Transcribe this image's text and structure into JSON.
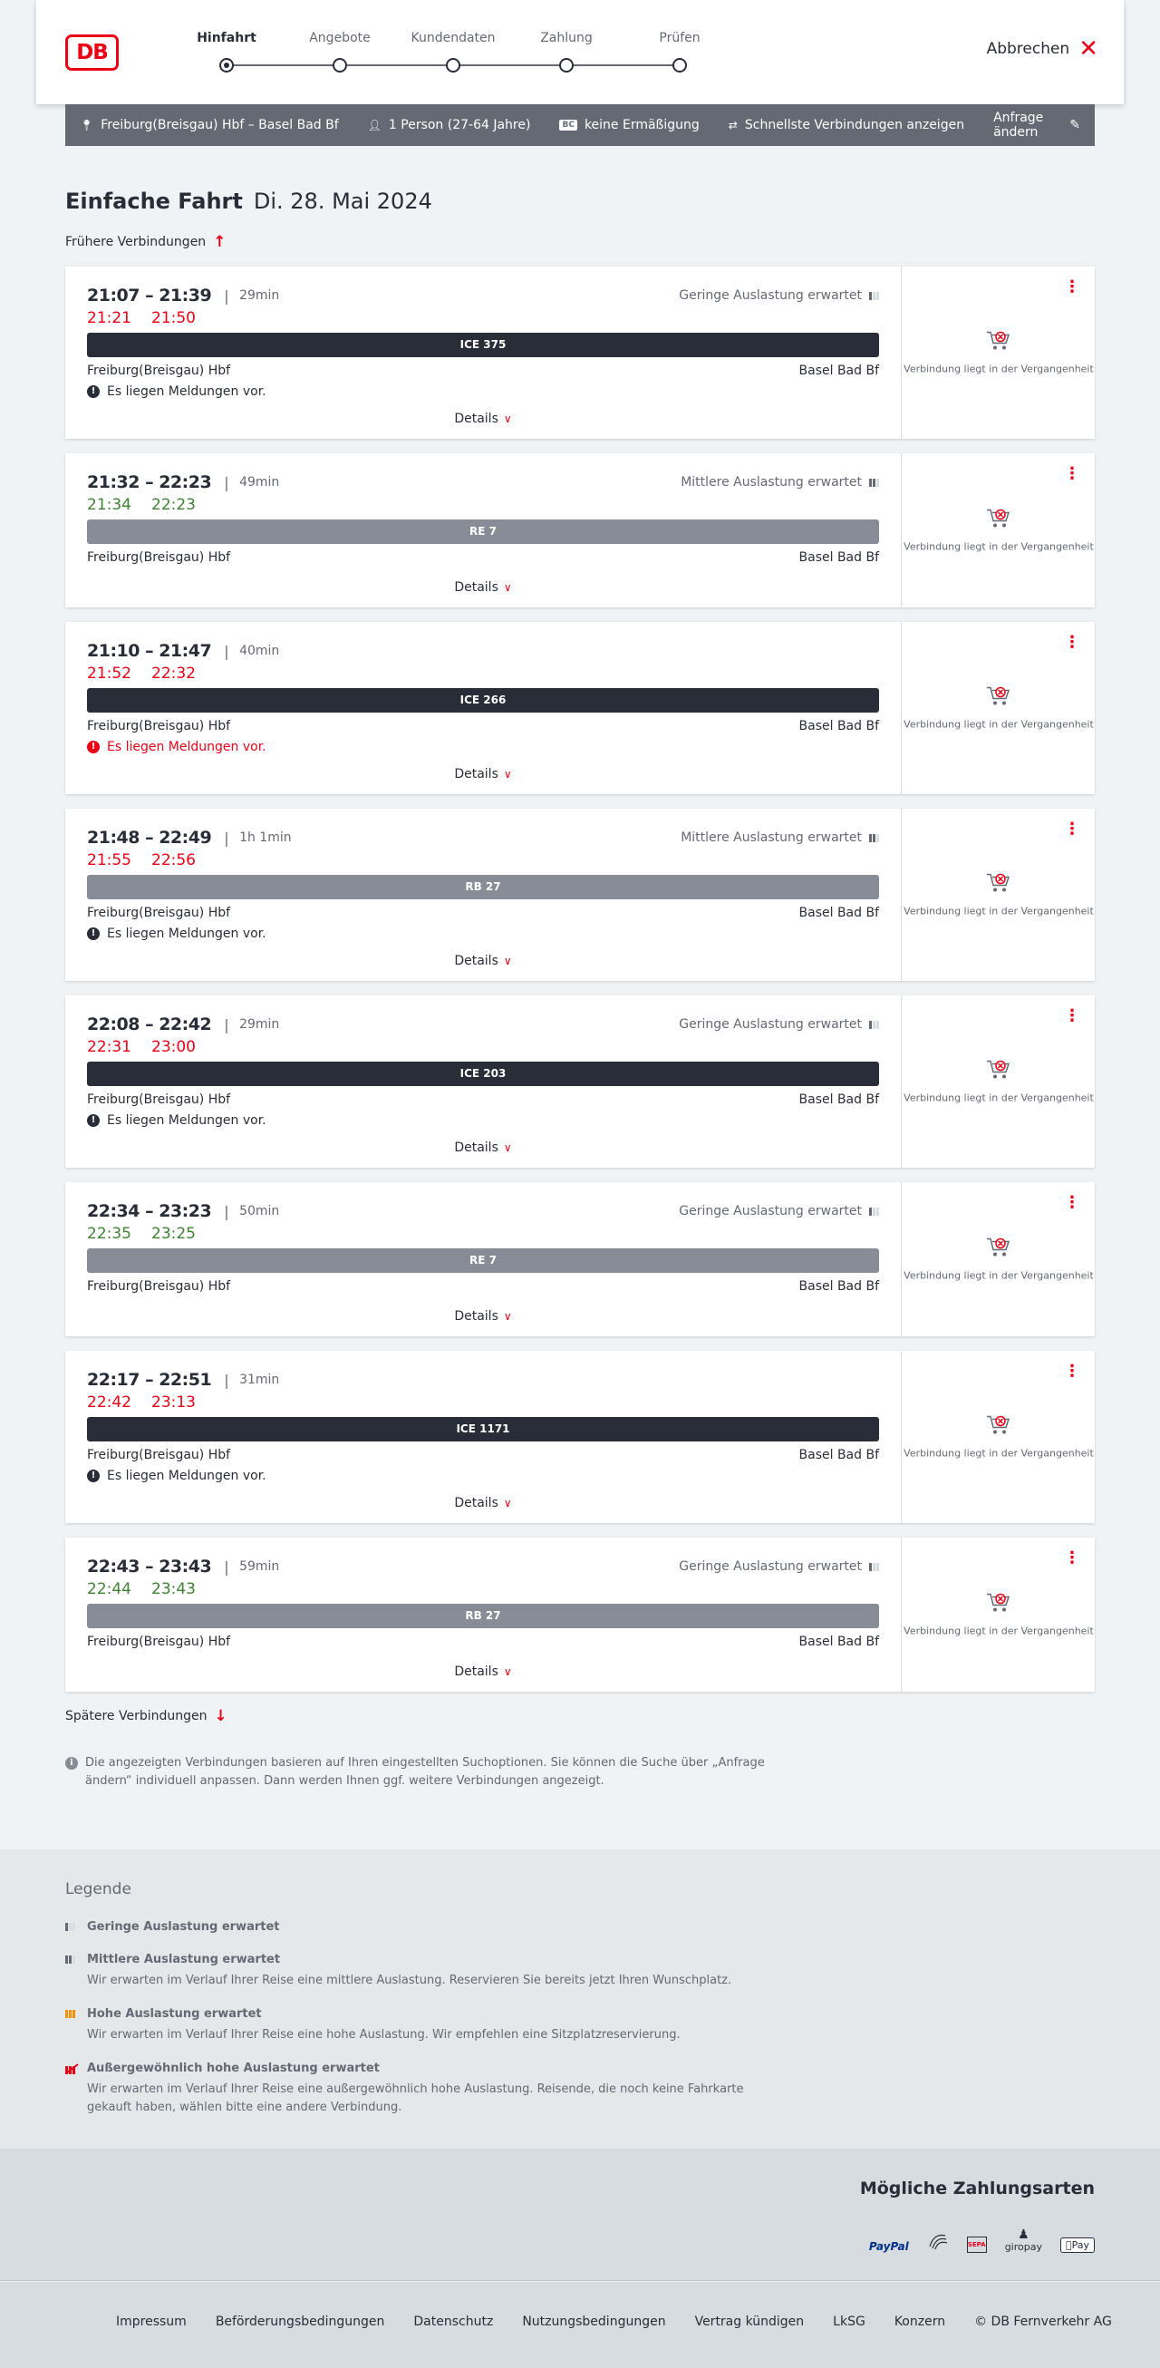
{
  "header": {
    "logo_text": "DB",
    "steps": [
      {
        "label": "Hinfahrt",
        "active": true
      },
      {
        "label": "Angebote",
        "active": false
      },
      {
        "label": "Kundendaten",
        "active": false
      },
      {
        "label": "Zahlung",
        "active": false
      },
      {
        "label": "Prüfen",
        "active": false
      }
    ],
    "cancel_label": "Abbrechen"
  },
  "search": {
    "route": "Freiburg(Breisgau) Hbf – Basel Bad Bf",
    "passengers": "1 Person (27-64 Jahre)",
    "discount": "keine Ermäßigung",
    "bc_badge": "BC",
    "fastest": "Schnellste Verbindungen anzeigen",
    "change_label": "Anfrage ändern"
  },
  "page": {
    "title_bold": "Einfache Fahrt",
    "title_date": "Di. 28. Mai 2024",
    "earlier_label": "Frühere Verbindungen",
    "later_label": "Spätere Verbindungen",
    "details_label": "Details",
    "cart_message": "Verbindung liegt in der Vergangenheit",
    "info_text": "Die angezeigten Verbindungen basieren auf Ihren eingestellten Suchoptionen. Sie können die Suche über „Anfrage ändern“ individuell anpassen. Dann werden Ihnen ggf. weitere Verbindungen angezeigt."
  },
  "connections": [
    {
      "time": "21:07 – 21:39",
      "duration": "29min",
      "rt_dep": "21:21",
      "rt_arr": "21:50",
      "rt_color": "red",
      "load": "Geringe Auslastung erwartet",
      "load_level": 1,
      "train": "ICE 375",
      "train_style": "dark",
      "from": "Freiburg(Breisgau) Hbf",
      "to": "Basel Bad Bf",
      "message": "Es liegen Meldungen vor.",
      "message_alert": false
    },
    {
      "time": "21:32 – 22:23",
      "duration": "49min",
      "rt_dep": "21:34",
      "rt_arr": "22:23",
      "rt_color": "green",
      "load": "Mittlere Auslastung erwartet",
      "load_level": 2,
      "train": "RE 7",
      "train_style": "grey",
      "from": "Freiburg(Breisgau) Hbf",
      "to": "Basel Bad Bf",
      "message": "",
      "message_alert": false
    },
    {
      "time": "21:10 – 21:47",
      "duration": "40min",
      "rt_dep": "21:52",
      "rt_arr": "22:32",
      "rt_color": "red",
      "load": "",
      "load_level": 0,
      "train": "ICE 266",
      "train_style": "dark",
      "from": "Freiburg(Breisgau) Hbf",
      "to": "Basel Bad Bf",
      "message": "Es liegen Meldungen vor.",
      "message_alert": true
    },
    {
      "time": "21:48 – 22:49",
      "duration": "1h 1min",
      "rt_dep": "21:55",
      "rt_arr": "22:56",
      "rt_color": "red",
      "load": "Mittlere Auslastung erwartet",
      "load_level": 2,
      "train": "RB 27",
      "train_style": "grey",
      "from": "Freiburg(Breisgau) Hbf",
      "to": "Basel Bad Bf",
      "message": "Es liegen Meldungen vor.",
      "message_alert": false
    },
    {
      "time": "22:08 – 22:42",
      "duration": "29min",
      "rt_dep": "22:31",
      "rt_arr": "23:00",
      "rt_color": "red",
      "load": "Geringe Auslastung erwartet",
      "load_level": 1,
      "train": "ICE 203",
      "train_style": "dark",
      "from": "Freiburg(Breisgau) Hbf",
      "to": "Basel Bad Bf",
      "message": "Es liegen Meldungen vor.",
      "message_alert": false
    },
    {
      "time": "22:34 – 23:23",
      "duration": "50min",
      "rt_dep": "22:35",
      "rt_arr": "23:25",
      "rt_color": "green",
      "load": "Geringe Auslastung erwartet",
      "load_level": 1,
      "train": "RE 7",
      "train_style": "grey",
      "from": "Freiburg(Breisgau) Hbf",
      "to": "Basel Bad Bf",
      "message": "",
      "message_alert": false
    },
    {
      "time": "22:17 – 22:51",
      "duration": "31min",
      "rt_dep": "22:42",
      "rt_arr": "23:13",
      "rt_color": "red",
      "load": "",
      "load_level": 0,
      "train": "ICE 1171",
      "train_style": "dark",
      "from": "Freiburg(Breisgau) Hbf",
      "to": "Basel Bad Bf",
      "message": "Es liegen Meldungen vor.",
      "message_alert": false
    },
    {
      "time": "22:43 – 23:43",
      "duration": "59min",
      "rt_dep": "22:44",
      "rt_arr": "23:43",
      "rt_color": "green",
      "load": "Geringe Auslastung erwartet",
      "load_level": 1,
      "train": "RB 27",
      "train_style": "grey",
      "from": "Freiburg(Breisgau) Hbf",
      "to": "Basel Bad Bf",
      "message": "",
      "message_alert": false
    }
  ],
  "legend": {
    "title": "Legende",
    "items": [
      {
        "title": "Geringe Auslastung erwartet",
        "desc": "",
        "level": 1
      },
      {
        "title": "Mittlere Auslastung erwartet",
        "desc": "Wir erwarten im Verlauf Ihrer Reise eine mittlere Auslastung. Reservieren Sie bereits jetzt Ihren Wunschplatz.",
        "level": 2
      },
      {
        "title": "Hohe Auslastung erwartet",
        "desc": "Wir erwarten im Verlauf Ihrer Reise eine hohe Auslastung. Wir empfehlen eine Sitzplatzreservierung.",
        "level": 3
      },
      {
        "title": "Außergewöhnlich hohe Auslastung erwartet",
        "desc": "Wir erwarten im Verlauf Ihrer Reise eine außergewöhnlich hohe Auslastung. Reisende, die noch keine Fahrkarte gekauft haben, wählen bitte eine andere Verbindung.",
        "level": 4
      }
    ]
  },
  "payments": {
    "title": "Mögliche Zahlungsarten",
    "methods": [
      "PayPal",
      "Kreditkarte",
      "SEPA",
      "giropay",
      "Pay"
    ]
  },
  "footer": {
    "links": [
      "Impressum",
      "Beförderungsbedingungen",
      "Datenschutz",
      "Nutzungsbedingungen",
      "Vertrag kündigen",
      "LkSG",
      "Konzern",
      "© DB Fernverkehr AG"
    ]
  },
  "colors": {
    "brand_red": "#ec0016",
    "delay_red": "#ec0016",
    "ontime_green": "#408335",
    "train_dark": "#282d37",
    "train_grey": "#878c96"
  }
}
